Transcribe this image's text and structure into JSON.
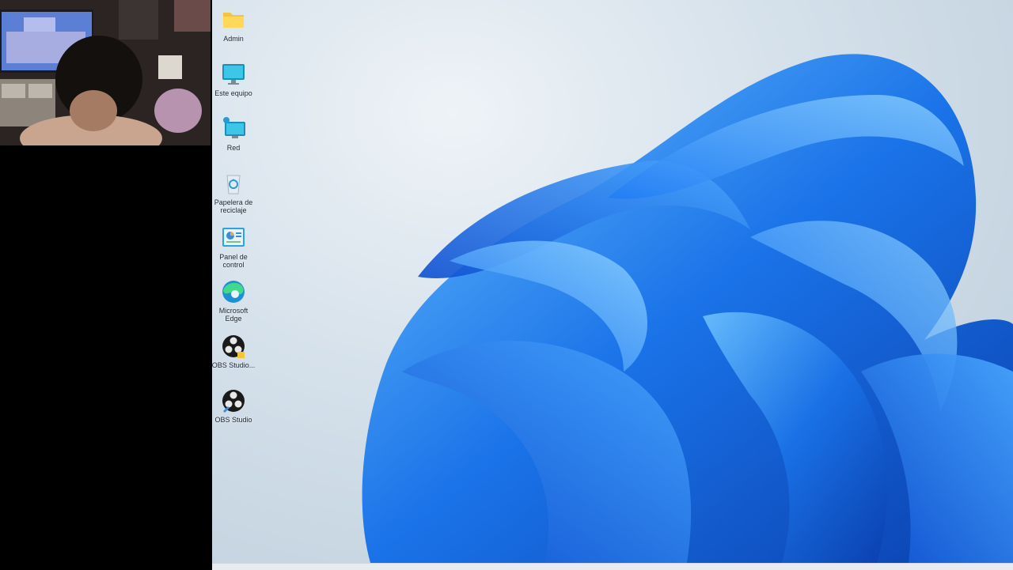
{
  "desktop_icons": [
    {
      "label": "Admin",
      "icon": "folder-icon"
    },
    {
      "label": "Este equipo",
      "icon": "monitor-icon"
    },
    {
      "label": "Red",
      "icon": "network-icon"
    },
    {
      "label": "Papelera de reciclaje",
      "icon": "recycle-bin-icon"
    },
    {
      "label": "Panel de control",
      "icon": "control-panel-icon"
    },
    {
      "label": "Microsoft Edge",
      "icon": "edge-icon"
    },
    {
      "label": "OBS Studio...",
      "icon": "obs-icon"
    },
    {
      "label": "OBS Studio",
      "icon": "obs-icon"
    }
  ],
  "colors": {
    "wallpaper_bg": "#d4e0ea",
    "bloom_blue": "#1a73e8",
    "bloom_light": "#4aa8ff",
    "bloom_dark": "#0a3fae"
  }
}
